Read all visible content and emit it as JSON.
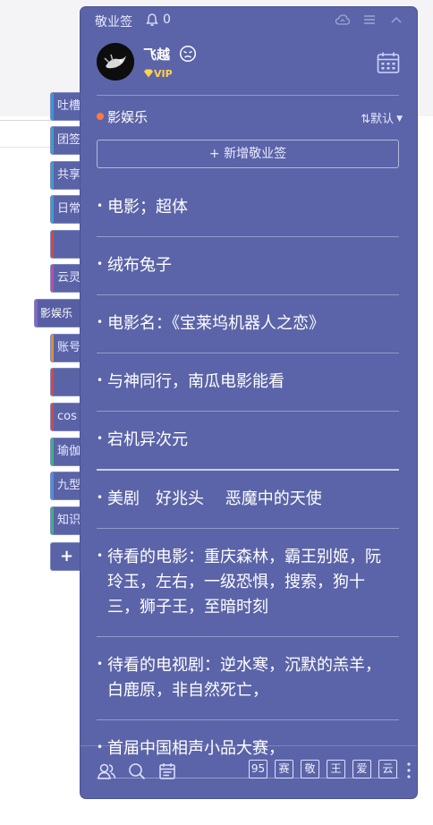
{
  "side_tabs": [
    {
      "label": "吐槽",
      "stripe": "#2e9bd8"
    },
    {
      "label": "团签",
      "stripe": "#3aa0c8"
    },
    {
      "label": "共享",
      "stripe": "#3aa0c8"
    },
    {
      "label": "日常",
      "stripe": "#3aa0c8"
    },
    {
      "label": "",
      "stripe": "#d9483b"
    },
    {
      "label": "云灵",
      "stripe": "#c24aa8"
    },
    {
      "label": "影娱乐",
      "stripe": "#8a63c7"
    },
    {
      "label": "账号",
      "stripe": "#e08f2e"
    },
    {
      "label": "",
      "stripe": "#d9483b"
    },
    {
      "label": "cos",
      "stripe": "#d9483b"
    },
    {
      "label": "瑜伽",
      "stripe": "#3cb37a"
    },
    {
      "label": "九型",
      "stripe": "#4a8fd8"
    },
    {
      "label": "知识",
      "stripe": "#3cb37a"
    },
    {
      "label": "+",
      "stripe": "#5b64a8"
    }
  ],
  "header": {
    "title": "敬业签",
    "bell_icon": "bell-icon",
    "notification_count": "0"
  },
  "user": {
    "name": "飞越",
    "badge": "VIP"
  },
  "category": {
    "label": "影娱乐",
    "sort_label": "默认",
    "dot_color": "#ff7a3c"
  },
  "add_button_label": "+ 新增敬业签",
  "notes": [
    "电影；超体",
    "绒布兔子",
    "电影名：《宝莱坞机器人之恋》",
    "与神同行，南瓜电影能看",
    "宕机异次元",
    "美剧　好兆头　 恶魔中的天使",
    "待看的电影：重庆森林，霸王别姬，阮玲玉，左右，一级恐惧，搜索，狗十三，狮子王，至暗时刻",
    "待看的电视剧：逆水寒，沉默的羔羊，白鹿原，非自然死亡，",
    "首届中国相声小品大赛，"
  ],
  "bottom_boxes": [
    "95",
    "赛",
    "敬",
    "王",
    "爱",
    "云"
  ],
  "colors": {
    "panel": "#5b64a8",
    "accent_dot": "#ff7a3c",
    "vip": "#ffd24a"
  }
}
